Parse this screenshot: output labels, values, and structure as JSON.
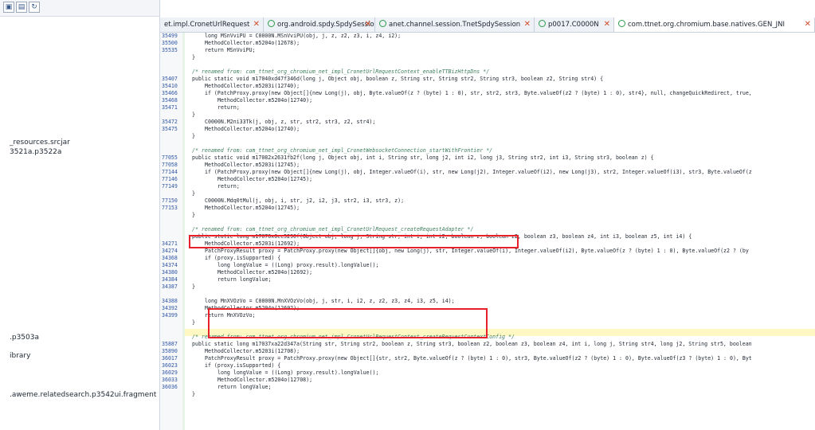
{
  "left_panel": {
    "toolbar_icons": [
      "tree-expand-icon",
      "tree-collapse-icon",
      "sync-icon"
    ],
    "tree_items": [
      "_resources.srcjar",
      "3521a.p3522a",
      ".p3503a",
      "ibrary",
      ".aweme.relatedsearch.p3542ui.fragment"
    ]
  },
  "tabs": [
    {
      "label": "et.impl.CronetUrlRequest"
    },
    {
      "label": "org.android.spdy.SpdySession"
    },
    {
      "label": "anet.channel.session.TnetSpdySession"
    },
    {
      "label": "p0017.C0000N"
    },
    {
      "label": "com.ttnet.org.chromium.base.natives.GEN_JNI"
    }
  ],
  "lines": [
    {
      "ln": "35499",
      "text": "long MSnVviPU = C0000N.MSnVviPU(obj, j, z, z2, z3, i, z4, i2);",
      "cls": ""
    },
    {
      "ln": "35500",
      "text": "MethodCollector.m5204o(12678);",
      "cls": ""
    },
    {
      "ln": "35535",
      "text": "return MSnVviPU;",
      "cls": ""
    },
    {
      "ln": "",
      "text": "}",
      "cls": ""
    },
    {
      "ln": "",
      "text": "",
      "cls": ""
    },
    {
      "ln": "",
      "text": "/* renamed from: com_ttnet_org_chromium_net_impl_CronetUrlRequestContext_enableTTBizHttpDns */",
      "cls": "comment"
    },
    {
      "ln": "35407",
      "text": "public static void m17040xd47f346d(long j, Object obj, boolean z, String str, String str2, String str3, boolean z2, String str4) {",
      "cls": ""
    },
    {
      "ln": "35410",
      "text": "MethodCollector.m5203i(12740);",
      "cls": ""
    },
    {
      "ln": "35466",
      "text": "if (PatchProxy.proxy(new Object[]{new Long(j), obj, Byte.valueOf(z ? (byte) 1 : 0), str, str2, str3, Byte.valueOf(z2 ? (byte) 1 : 0), str4}, null, changeQuickRedirect, true,",
      "cls": ""
    },
    {
      "ln": "35468",
      "text": "MethodCollector.m5204o(12740);",
      "cls": ""
    },
    {
      "ln": "35471",
      "text": "return;",
      "cls": ""
    },
    {
      "ln": "",
      "text": "}",
      "cls": ""
    },
    {
      "ln": "35472",
      "text": "C0000N.M2ni33Tk(j, obj, z, str, str2, str3, z2, str4);",
      "cls": ""
    },
    {
      "ln": "35475",
      "text": "MethodCollector.m5204o(12740);",
      "cls": ""
    },
    {
      "ln": "",
      "text": "}",
      "cls": ""
    },
    {
      "ln": "",
      "text": "",
      "cls": ""
    },
    {
      "ln": "",
      "text": "/* renamed from: com_ttnet_org_chromium_net_impl_CronetWebsocketConnection_startWithFrontier */",
      "cls": "comment"
    },
    {
      "ln": "77055",
      "text": "public static void m17082x2631fb2f(long j, Object obj, int i, String str, long j2, int i2, long j3, String str2, int i3, String str3, boolean z) {",
      "cls": ""
    },
    {
      "ln": "77058",
      "text": "MethodCollector.m5203i(12745);",
      "cls": ""
    },
    {
      "ln": "77144",
      "text": "if (PatchProxy.proxy(new Object[]{new Long(j), obj, Integer.valueOf(i), str, new Long(j2), Integer.valueOf(i2), new Long(j3), str2, Integer.valueOf(i3), str3, Byte.valueOf(z",
      "cls": ""
    },
    {
      "ln": "77146",
      "text": "MethodCollector.m5204o(12745);",
      "cls": ""
    },
    {
      "ln": "77149",
      "text": "return;",
      "cls": ""
    },
    {
      "ln": "",
      "text": "}",
      "cls": ""
    },
    {
      "ln": "77150",
      "text": "C0000N.Mdq0tMul(j, obj, i, str, j2, i2, j3, str2, i3, str3, z);",
      "cls": ""
    },
    {
      "ln": "77153",
      "text": "MethodCollector.m5204o(12745);",
      "cls": ""
    },
    {
      "ln": "",
      "text": "}",
      "cls": ""
    },
    {
      "ln": "",
      "text": "",
      "cls": ""
    },
    {
      "ln": "",
      "text": "/* renamed from: com_ttnet_org_chromium_net_impl_CronetUrlRequest_createRequestAdapter */",
      "cls": "comment"
    },
    {
      "ln": "",
      "text": "public static long m17070x6cc5290f(Object obj, long j, String str, int i, int i2, boolean z, boolean z2, boolean z3, boolean z4, int i3, boolean z5, int i4) {",
      "cls": ""
    },
    {
      "ln": "34271",
      "text": "MethodCollector.m5203i(12692);",
      "cls": ""
    },
    {
      "ln": "34274",
      "text": "PatchProxyResult proxy = PatchProxy.proxy(new Object[]{obj, new Long(j), str, Integer.valueOf(i), Integer.valueOf(i2), Byte.valueOf(z ? (byte) 1 : 0), Byte.valueOf(z2 ? (by",
      "cls": ""
    },
    {
      "ln": "34368",
      "text": "if (proxy.isSupported) {",
      "cls": ""
    },
    {
      "ln": "34374",
      "text": "long longValue = ((Long) proxy.result).longValue();",
      "cls": ""
    },
    {
      "ln": "34380",
      "text": "MethodCollector.m5204o(12692);",
      "cls": ""
    },
    {
      "ln": "34384",
      "text": "return longValue;",
      "cls": ""
    },
    {
      "ln": "34387",
      "text": "}",
      "cls": ""
    },
    {
      "ln": "",
      "text": "",
      "cls": ""
    },
    {
      "ln": "34388",
      "text": "long MnXVOzVo = C0000N.MnXVOzVo(obj, j, str, i, i2, z, z2, z3, z4, i3, z5, i4);",
      "cls": ""
    },
    {
      "ln": "34392",
      "text": "MethodCollector.m5204o(12692);",
      "cls": ""
    },
    {
      "ln": "34399",
      "text": "return MnXVOzVo;",
      "cls": ""
    },
    {
      "ln": "",
      "text": "}",
      "cls": ""
    },
    {
      "ln": "",
      "text": "",
      "cls": ""
    },
    {
      "ln": "",
      "text": "/* renamed from: com_ttnet_org_chromium_net_impl_CronetUrlRequestContext_createRequestContextConfig */",
      "cls": "comment"
    },
    {
      "ln": "35887",
      "text": "public static long m17037xa22d347a(String str, String str2, boolean z, String str3, boolean z2, boolean z3, boolean z4, int i, long j, String str4, long j2, String str5, boolean",
      "cls": ""
    },
    {
      "ln": "35890",
      "text": "MethodCollector.m5203i(12708);",
      "cls": ""
    },
    {
      "ln": "36017",
      "text": "PatchProxyResult proxy = PatchProxy.proxy(new Object[]{str, str2, Byte.valueOf(z ? (byte) 1 : 0), str3, Byte.valueOf(z2 ? (byte) 1 : 0), Byte.valueOf(z3 ? (byte) 1 : 0), Byt",
      "cls": ""
    },
    {
      "ln": "36023",
      "text": "if (proxy.isSupported) {",
      "cls": ""
    },
    {
      "ln": "36029",
      "text": "long longValue = ((Long) proxy.result).longValue();",
      "cls": ""
    },
    {
      "ln": "36033",
      "text": "MethodCollector.m5204o(12708);",
      "cls": ""
    },
    {
      "ln": "36036",
      "text": "return longValue;",
      "cls": ""
    },
    {
      "ln": "",
      "text": "}",
      "cls": ""
    }
  ]
}
